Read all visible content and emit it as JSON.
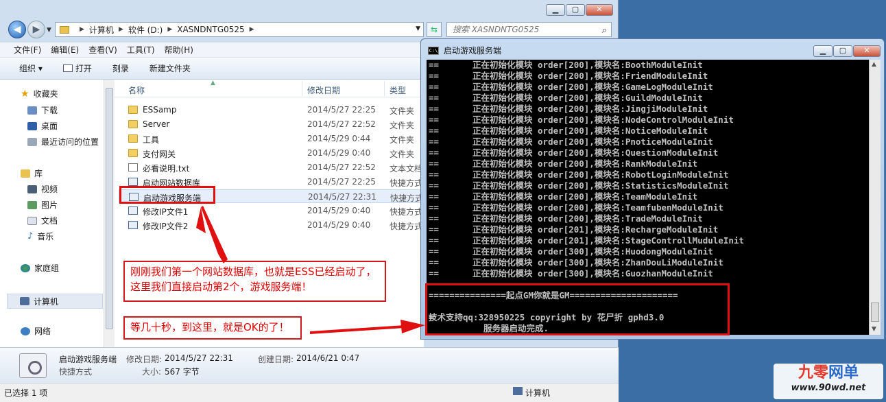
{
  "explorer": {
    "address": {
      "segments": [
        "计算机",
        "软件 (D:)",
        "XASNDNTG0525"
      ]
    },
    "search_placeholder": "搜索 XASNDNTG0525",
    "menu": [
      "文件(F)",
      "编辑(E)",
      "查看(V)",
      "工具(T)",
      "帮助(H)"
    ],
    "toolbar": {
      "organize": "组织 ▾",
      "open": "打开",
      "burn": "刻录",
      "new_folder": "新建文件夹"
    },
    "nav": {
      "favorites": "收藏夹",
      "downloads": "下载",
      "desktop": "桌面",
      "recent": "最近访问的位置",
      "libraries": "库",
      "videos": "视频",
      "pictures": "图片",
      "documents": "文档",
      "music": "音乐",
      "homegroup": "家庭组",
      "computer": "计算机",
      "network": "网络"
    },
    "columns": {
      "name": "名称",
      "date": "修改日期",
      "type": "类型"
    },
    "files": [
      {
        "name": "ESSamp",
        "date": "2014/5/27 22:25",
        "type": "文件夹",
        "kind": "folder"
      },
      {
        "name": "Server",
        "date": "2014/5/27 22:52",
        "type": "文件夹",
        "kind": "folder"
      },
      {
        "name": "工具",
        "date": "2014/5/29 0:44",
        "type": "文件夹",
        "kind": "folder"
      },
      {
        "name": "支付网关",
        "date": "2014/5/29 0:40",
        "type": "文件夹",
        "kind": "folder"
      },
      {
        "name": "必看说明.txt",
        "date": "2014/5/27 22:52",
        "type": "文本文档",
        "kind": "txt"
      },
      {
        "name": "启动网站数据库",
        "date": "2014/5/27 22:25",
        "type": "快捷方式",
        "kind": "lnk"
      },
      {
        "name": "启动游戏服务端",
        "date": "2014/5/27 22:31",
        "type": "快捷方式",
        "kind": "lnk"
      },
      {
        "name": "修改IP文件1",
        "date": "2014/5/29 0:40",
        "type": "快捷方式",
        "kind": "lnk"
      },
      {
        "name": "修改IP文件2",
        "date": "2014/5/29 0:40",
        "type": "快捷方式",
        "kind": "lnk"
      }
    ],
    "details": {
      "name": "启动游戏服务端",
      "type": "快捷方式",
      "modified_label": "修改日期:",
      "modified": "2014/5/27 22:31",
      "created_label": "创建日期:",
      "created": "2014/6/21 0:47",
      "size_label": "大小:",
      "size": "567 字节"
    },
    "status": {
      "selection": "已选择 1 项",
      "location": "计算机"
    }
  },
  "console": {
    "title": "启动游戏服务端",
    "init_lines": [
      {
        "order": "200",
        "module": "BoothModuleInit"
      },
      {
        "order": "200",
        "module": "FriendModuleInit"
      },
      {
        "order": "200",
        "module": "GameLogModuleInit"
      },
      {
        "order": "200",
        "module": "GuildModuleInit"
      },
      {
        "order": "200",
        "module": "JingjiModuleInit"
      },
      {
        "order": "200",
        "module": "NodeControlModuleInit"
      },
      {
        "order": "200",
        "module": "NoticeModuleInit"
      },
      {
        "order": "200",
        "module": "PnoticeModuleInit"
      },
      {
        "order": "200",
        "module": "QuestionModuleInit"
      },
      {
        "order": "200",
        "module": "RankModuleInit"
      },
      {
        "order": "200",
        "module": "RobotLoginModuleInit"
      },
      {
        "order": "200",
        "module": "StatisticsModuleInit"
      },
      {
        "order": "200",
        "module": "TeamModuleInit"
      },
      {
        "order": "200",
        "module": "TeamfubenModuleInit"
      },
      {
        "order": "200",
        "module": "TradeModuleInit"
      },
      {
        "order": "201",
        "module": "RechargeModuleInit"
      },
      {
        "order": "201",
        "module": "StageControllMuduleInit"
      },
      {
        "order": "300",
        "module": "HuodongModuleInit"
      },
      {
        "order": "300",
        "module": "ZhanDouLiModuleInit"
      },
      {
        "order": "300",
        "module": "GuozhanModuleInit"
      }
    ],
    "line_prefix": "==",
    "init_text": "正在初始化模块 order[",
    "init_mid": "],模块名:",
    "banner": "===============起点GM你就是GM=====================",
    "ready_prefix": "=",
    "ready": "服务器启动完成.",
    "copyright": "技术支持qq:328950225 copyright by 花尸折 gphd3.0"
  },
  "annotations": {
    "callout1_line1": "刚刚我们第一个网站数据库，也就是ESS已经启动了，",
    "callout1_line2": "这里我们直接启动第2个，游戏服务端！",
    "callout2": "等几十秒，到这里，就是OK的了！"
  },
  "watermark": {
    "part1": "九零",
    "part2": "网单",
    "url": "www.90wd.net"
  },
  "colors": {
    "annotation_red": "#e01010",
    "console_bg": "#000000",
    "console_text": "#c0c0c0"
  }
}
